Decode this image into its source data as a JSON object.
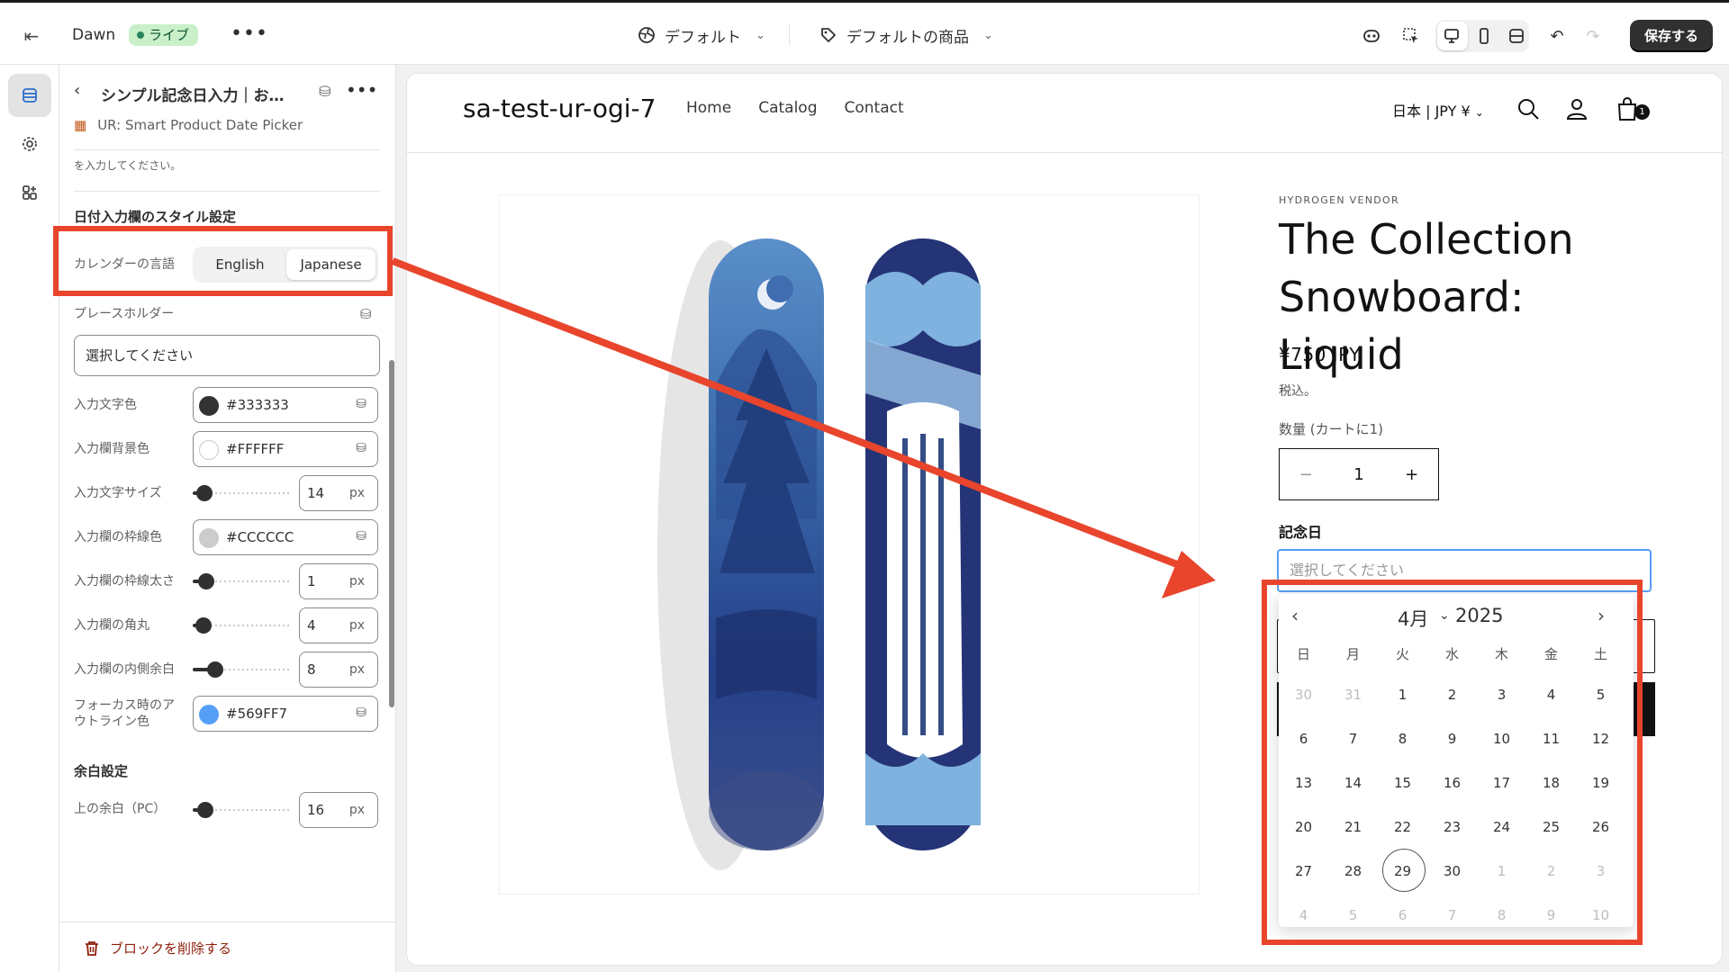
{
  "topbar": {
    "theme_name": "Dawn",
    "live_badge": "ライブ",
    "more": "•••",
    "context_select": "デフォルト",
    "template_select": "デフォルトの商品",
    "save": "保存する"
  },
  "panel": {
    "header": {
      "back": "<",
      "title": "シンプル記念日入力｜お…",
      "more": "•••"
    },
    "app_name": "UR: Smart Product Date Picker",
    "help_text": "を入力してください。",
    "style_section_title": "日付入力欄のスタイル設定",
    "calendar_language": {
      "label": "カレンダーの言語",
      "options": [
        "English",
        "Japanese"
      ],
      "selected": "Japanese"
    },
    "placeholder": {
      "label": "プレースホルダー",
      "value": "選択してください"
    },
    "text_color": {
      "label": "入力文字色",
      "value": "#333333"
    },
    "bg_color": {
      "label": "入力欄背景色",
      "value": "#FFFFFF"
    },
    "font_size": {
      "label": "入力文字サイズ",
      "value": "14",
      "unit": "px",
      "level": 0.12
    },
    "border_color": {
      "label": "入力欄の枠線色",
      "value": "#CCCCCC"
    },
    "border_width": {
      "label": "入力欄の枠線太さ",
      "value": "1",
      "unit": "px",
      "level": 0.14
    },
    "border_radius": {
      "label": "入力欄の角丸",
      "value": "4",
      "unit": "px",
      "level": 0.11
    },
    "padding": {
      "label": "入力欄の内側余白",
      "value": "8",
      "unit": "px",
      "level": 0.23
    },
    "focus_color": {
      "label_1": "フォーカス時のア",
      "label_2": "ウトライン色",
      "value": "#569FF7"
    },
    "spacing_section_title": "余白設定",
    "top_margin_pc": {
      "label": "上の余白（PC）",
      "value": "16",
      "unit": "px",
      "level": 0.13
    },
    "delete_block": "ブロックを削除する"
  },
  "store": {
    "logo": "sa-test-ur-ogi-7",
    "nav": [
      "Home",
      "Catalog",
      "Contact"
    ],
    "currency": "日本 | JPY ¥",
    "cart_count": "1",
    "product": {
      "vendor": "HYDROGEN VENDOR",
      "title": "The Collection Snowboard: Liquid",
      "price": "¥750 JPY",
      "tax_note": "税込。",
      "quantity_label": "数量 (カートに1)",
      "quantity": "1",
      "anniversary_label": "記念日",
      "date_placeholder": "選択してください"
    }
  },
  "calendar": {
    "month": "4月",
    "year": "2025",
    "weekdays": [
      "日",
      "月",
      "火",
      "水",
      "木",
      "金",
      "土"
    ],
    "weeks": [
      [
        "30",
        "31",
        "1",
        "2",
        "3",
        "4",
        "5"
      ],
      [
        "6",
        "7",
        "8",
        "9",
        "10",
        "11",
        "12"
      ],
      [
        "13",
        "14",
        "15",
        "16",
        "17",
        "18",
        "19"
      ],
      [
        "20",
        "21",
        "22",
        "23",
        "24",
        "25",
        "26"
      ],
      [
        "27",
        "28",
        "29",
        "30",
        "1",
        "2",
        "3"
      ],
      [
        "4",
        "5",
        "6",
        "7",
        "8",
        "9",
        "10"
      ]
    ],
    "today": "29"
  },
  "colors": {
    "annotation": "#e8452c",
    "focus": "#569ff7",
    "accent": "#303030"
  }
}
